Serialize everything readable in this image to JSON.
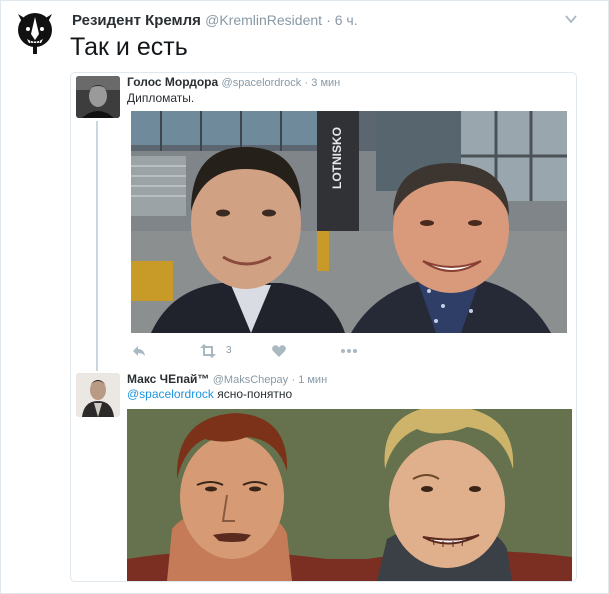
{
  "tweet": {
    "author_name": "Резидент Кремля",
    "author_handle": "@KremlinResident",
    "time": "· 6 ч.",
    "text": "Так и есть",
    "avatar_icon": "badger-icon"
  },
  "quoted_thread": {
    "first": {
      "author_name": "Голос Мордора",
      "author_handle": "@spacelordrock",
      "time": "· 3 мин",
      "text": "Дипломаты.",
      "photo_sign_text": "LOTNISKO",
      "retweet_count": "3"
    },
    "reply": {
      "author_name": "Макс ЧЕпай™",
      "author_handle": "@MaksChepay",
      "time": "· 1 мин",
      "mention": "@spacelordrock",
      "text": "ясно-понятно"
    }
  },
  "icons": {
    "caret": "chevron-down-icon",
    "reply": "reply-icon",
    "retweet": "retweet-icon",
    "like": "heart-icon",
    "more": "more-icon"
  },
  "colors": {
    "link": "#1b95e0",
    "muted": "#8899a6",
    "border": "#e1e8ed"
  }
}
